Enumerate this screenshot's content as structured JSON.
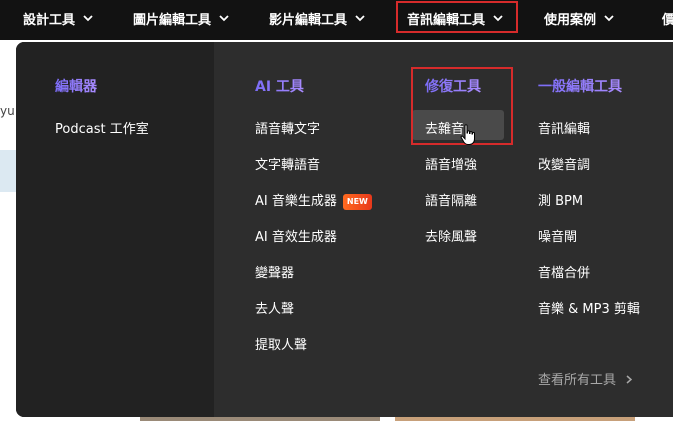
{
  "nav": {
    "items": [
      {
        "label": "設計工具"
      },
      {
        "label": "圖片編輯工具"
      },
      {
        "label": "影片編輯工具"
      },
      {
        "label": "音訊編輯工具"
      },
      {
        "label": "使用案例"
      },
      {
        "label": "價"
      }
    ]
  },
  "background": {
    "left_text": "yu"
  },
  "menu": {
    "editor": {
      "heading": "編輯器",
      "items": [
        {
          "label": "Podcast 工作室"
        }
      ]
    },
    "ai_tools": {
      "heading": "AI 工具",
      "items": [
        {
          "label": "語音轉文字"
        },
        {
          "label": "文字轉語音"
        },
        {
          "label": "AI 音樂生成器",
          "badge": "NEW"
        },
        {
          "label": "AI 音效生成器"
        },
        {
          "label": "變聲器"
        },
        {
          "label": "去人聲"
        },
        {
          "label": "提取人聲"
        }
      ]
    },
    "repair_tools": {
      "heading": "修復工具",
      "items": [
        {
          "label": "去雜音"
        },
        {
          "label": "語音增強"
        },
        {
          "label": "語音隔離"
        },
        {
          "label": "去除風聲"
        }
      ]
    },
    "general_tools": {
      "heading": "一般編輯工具",
      "items": [
        {
          "label": "音訊編輯"
        },
        {
          "label": "改變音調"
        },
        {
          "label": "測 BPM"
        },
        {
          "label": "噪音閘"
        },
        {
          "label": "音檔合併"
        },
        {
          "label": "音樂 & MP3 剪輯"
        }
      ]
    },
    "view_all": "查看所有工具"
  },
  "colors": {
    "heading_gradient": [
      "#7b6cf6",
      "#a98bff"
    ],
    "highlight_red": "#d62b2b",
    "new_badge": "#ff5a1f"
  }
}
